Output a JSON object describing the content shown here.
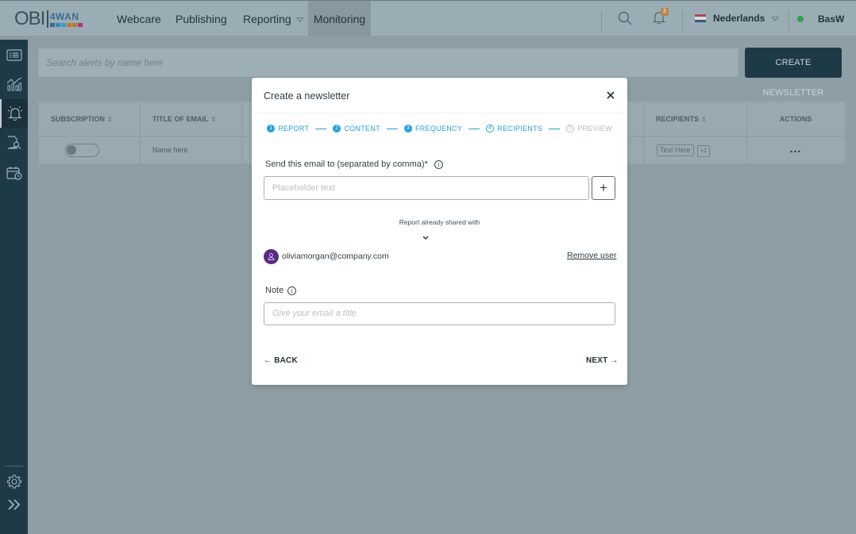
{
  "header": {
    "logo_text": "OBI",
    "logo_brand": "4WAN",
    "logo_colors": [
      "#3a6d8e",
      "#3c88b5",
      "#2f9fd0",
      "#c27a2e",
      "#b7783e",
      "#b0327a"
    ],
    "nav": [
      {
        "label": "Webcare",
        "active": false
      },
      {
        "label": "Publishing",
        "active": false
      },
      {
        "label": "Reporting",
        "active": false,
        "has_dropdown": true
      },
      {
        "label": "Monitoring",
        "active": true
      }
    ],
    "notification_count": "3",
    "language": "Nederlands",
    "user": "BasW",
    "status_color": "#2da24b"
  },
  "sidebar": {
    "items": [
      {
        "icon": "list-icon",
        "active": false
      },
      {
        "icon": "analytics-chart-icon",
        "active": false
      },
      {
        "icon": "alert-bell-icon",
        "active": true
      },
      {
        "icon": "document-search-icon",
        "active": false
      },
      {
        "icon": "calendar-clock-icon",
        "active": false
      }
    ],
    "bottom": [
      {
        "icon": "gear-icon"
      },
      {
        "icon": "expand-chevrons-icon"
      }
    ]
  },
  "main": {
    "search_placeholder": "Search alerts by name  here",
    "create_button": "CREATE NEWSLETTER",
    "table": {
      "columns": [
        "SUBSCRIPTION",
        "TITLE OF EMAIL",
        "RECIPIENTS",
        "ACTIONS"
      ],
      "rows": [
        {
          "subscription_on": false,
          "title": "Name here",
          "recipients": [
            "Text Here"
          ],
          "recipients_more": "+1",
          "actions": "..."
        }
      ]
    }
  },
  "modal": {
    "title": "Create a newsletter",
    "steps": [
      {
        "num": "1",
        "label": "REPORT",
        "state": "done"
      },
      {
        "num": "2",
        "label": "CONTENT",
        "state": "done"
      },
      {
        "num": "3",
        "label": "FREQUENCY",
        "state": "done"
      },
      {
        "num": "4",
        "label": "RECIPIENTS",
        "state": "current"
      },
      {
        "num": "5",
        "label": "PREVIEW",
        "state": "todo"
      }
    ],
    "send_label": "Send this email to (separated by comma)*",
    "send_placeholder": "Placeholder text",
    "add_button": "+",
    "shared_label": "Report already shared with",
    "shared_users": [
      {
        "email": "oliviamorgan@company.com",
        "remove_label": "Remove user"
      }
    ],
    "note_label": "Note",
    "note_placeholder": "Give your email a title",
    "back_label": "BACK",
    "next_label": "NEXT",
    "accent_color": "#1fa0e0"
  }
}
